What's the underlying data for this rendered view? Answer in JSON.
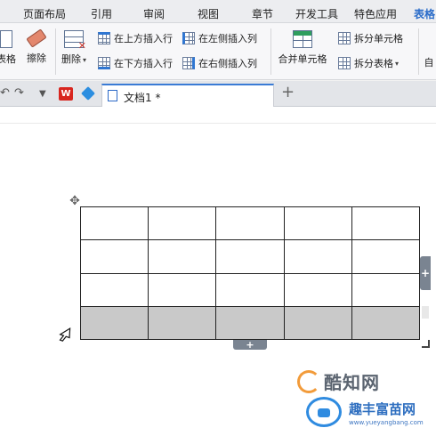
{
  "menu": {
    "tabs": [
      "页面布局",
      "引用",
      "审阅",
      "视图",
      "章节",
      "开发工具",
      "特色应用",
      "表格"
    ],
    "active": "表格"
  },
  "ribbon": {
    "table_label": "表格",
    "erase_label": "擦除",
    "delete_label": "删除",
    "insert_above": "在上方插入行",
    "insert_below": "在下方插入行",
    "insert_left": "在左侧插入列",
    "insert_right": "在右侧插入列",
    "merge_cells": "合并单元格",
    "split_cells": "拆分单元格",
    "split_table": "拆分表格",
    "auto_fit": "自"
  },
  "quickbar": {
    "doc_tab": "文档1 *",
    "new_tab": "+"
  },
  "table": {
    "rows": 4,
    "cols": 5,
    "selected_row": 4,
    "add_symbol": "+"
  },
  "watermark": {
    "line1": "酷知网",
    "line2": "趣丰富苗网",
    "url": "www.yueyangbang.com"
  },
  "colors": {
    "accent": "#2a6cc9",
    "selection": "#c9c9c9",
    "handle": "#7a8491"
  }
}
